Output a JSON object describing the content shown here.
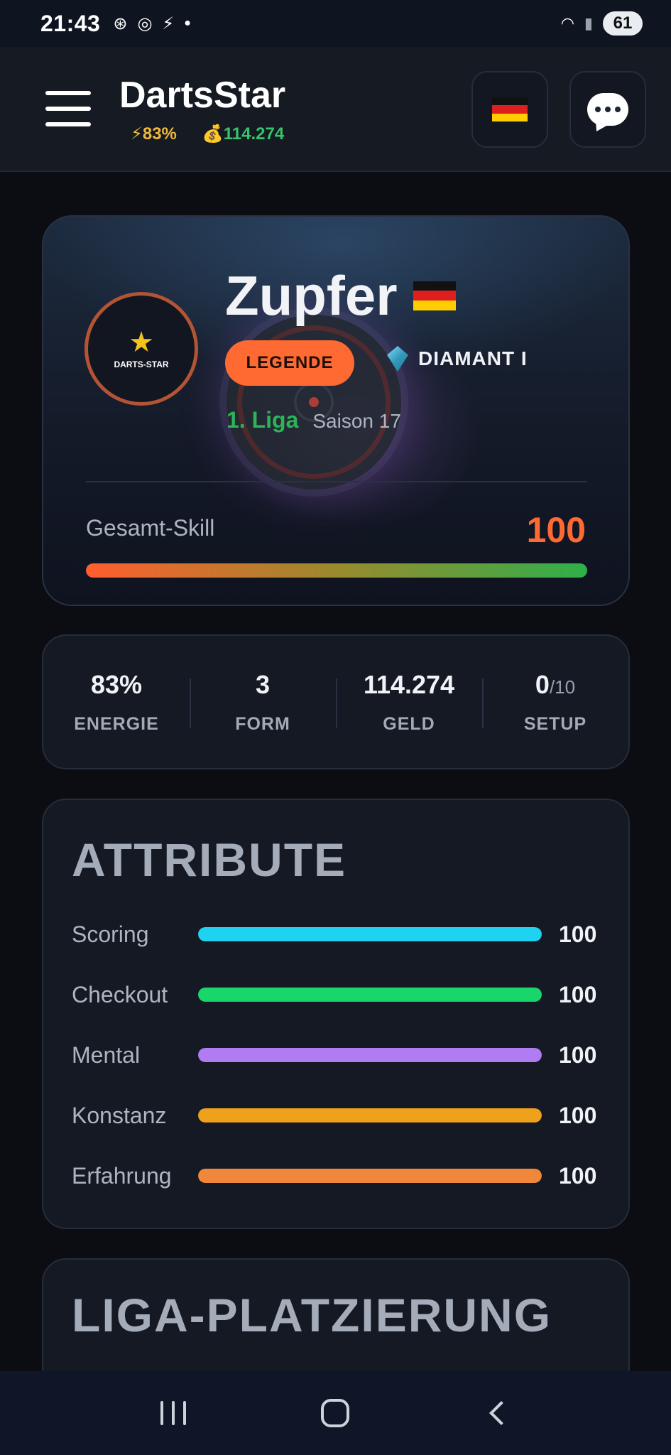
{
  "status_bar": {
    "time": "21:43",
    "battery": "61",
    "icons": [
      "openai-icon",
      "chrome-icon",
      "app-icon",
      "dot-icon",
      "wifi-icon",
      "signal-icon"
    ]
  },
  "header": {
    "title": "DartsStar",
    "energy": "⚡83%",
    "money": "💰114.274",
    "language_flag": "de",
    "chat_icon": "chat-bubble-icon"
  },
  "profile": {
    "avatar_text": "DARTS-STAR",
    "name": "Zupfer",
    "rank_badge": "LEGENDE",
    "tier": "DIAMANT I",
    "league": "1. Liga",
    "season": "Saison 17",
    "skill_label": "Gesamt-Skill",
    "skill_value": "100",
    "skill_fraction": 1.0
  },
  "stats": [
    {
      "value": "83%",
      "sub": "",
      "label": "ENERGIE"
    },
    {
      "value": "3",
      "sub": "",
      "label": "FORM"
    },
    {
      "value": "114.274",
      "sub": "",
      "label": "GELD"
    },
    {
      "value": "0",
      "sub": "/10",
      "label": "SETUP"
    }
  ],
  "attributes": {
    "title": "ATTRIBUTE",
    "items": [
      {
        "name": "Scoring",
        "value": "100",
        "fraction": 1.0,
        "color": "#1fd3f0"
      },
      {
        "name": "Checkout",
        "value": "100",
        "fraction": 1.0,
        "color": "#19d66a"
      },
      {
        "name": "Mental",
        "value": "100",
        "fraction": 1.0,
        "color": "#b07cf2"
      },
      {
        "name": "Konstanz",
        "value": "100",
        "fraction": 1.0,
        "color": "#f0a11c"
      },
      {
        "name": "Erfahrung",
        "value": "100",
        "fraction": 1.0,
        "color": "#f0873a"
      }
    ]
  },
  "liga_section": {
    "title": "LIGA-PLATZIERUNG"
  },
  "colors": {
    "accent_orange": "#ff6a33",
    "league_green": "#2bb558",
    "background": "#0b0d12"
  }
}
